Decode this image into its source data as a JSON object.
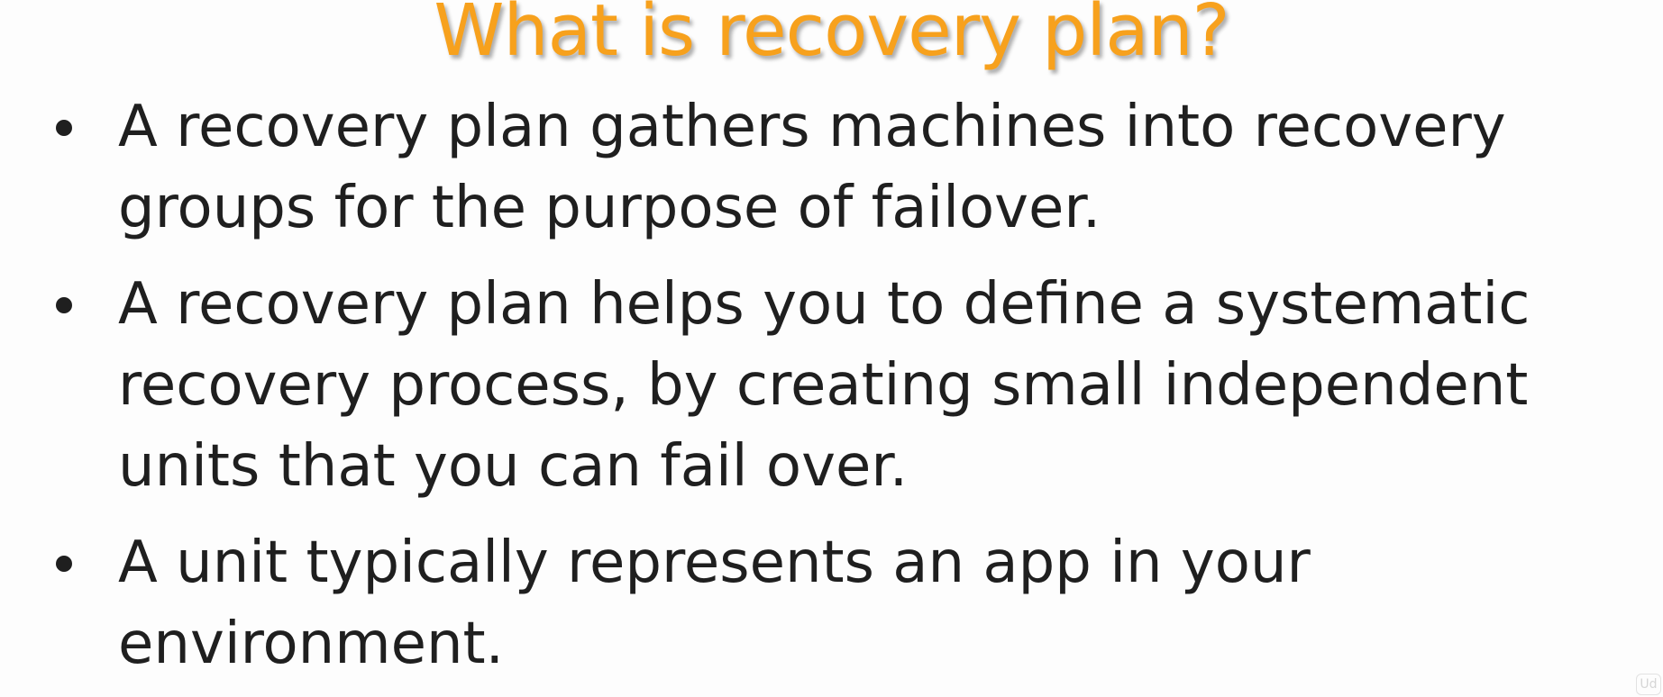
{
  "slide": {
    "title": "What is recovery plan?",
    "bullets": [
      "A recovery plan gathers machines into recovery groups for the purpose of failover.",
      "A recovery plan helps you to define a systematic recovery process, by creating small independent units that you can fail over.",
      "A unit typically represents an app in your environment."
    ],
    "watermark": "Ud"
  },
  "colors": {
    "title": "#f7a11d",
    "text": "#1f1f1f",
    "background": "#fdfdfd"
  }
}
